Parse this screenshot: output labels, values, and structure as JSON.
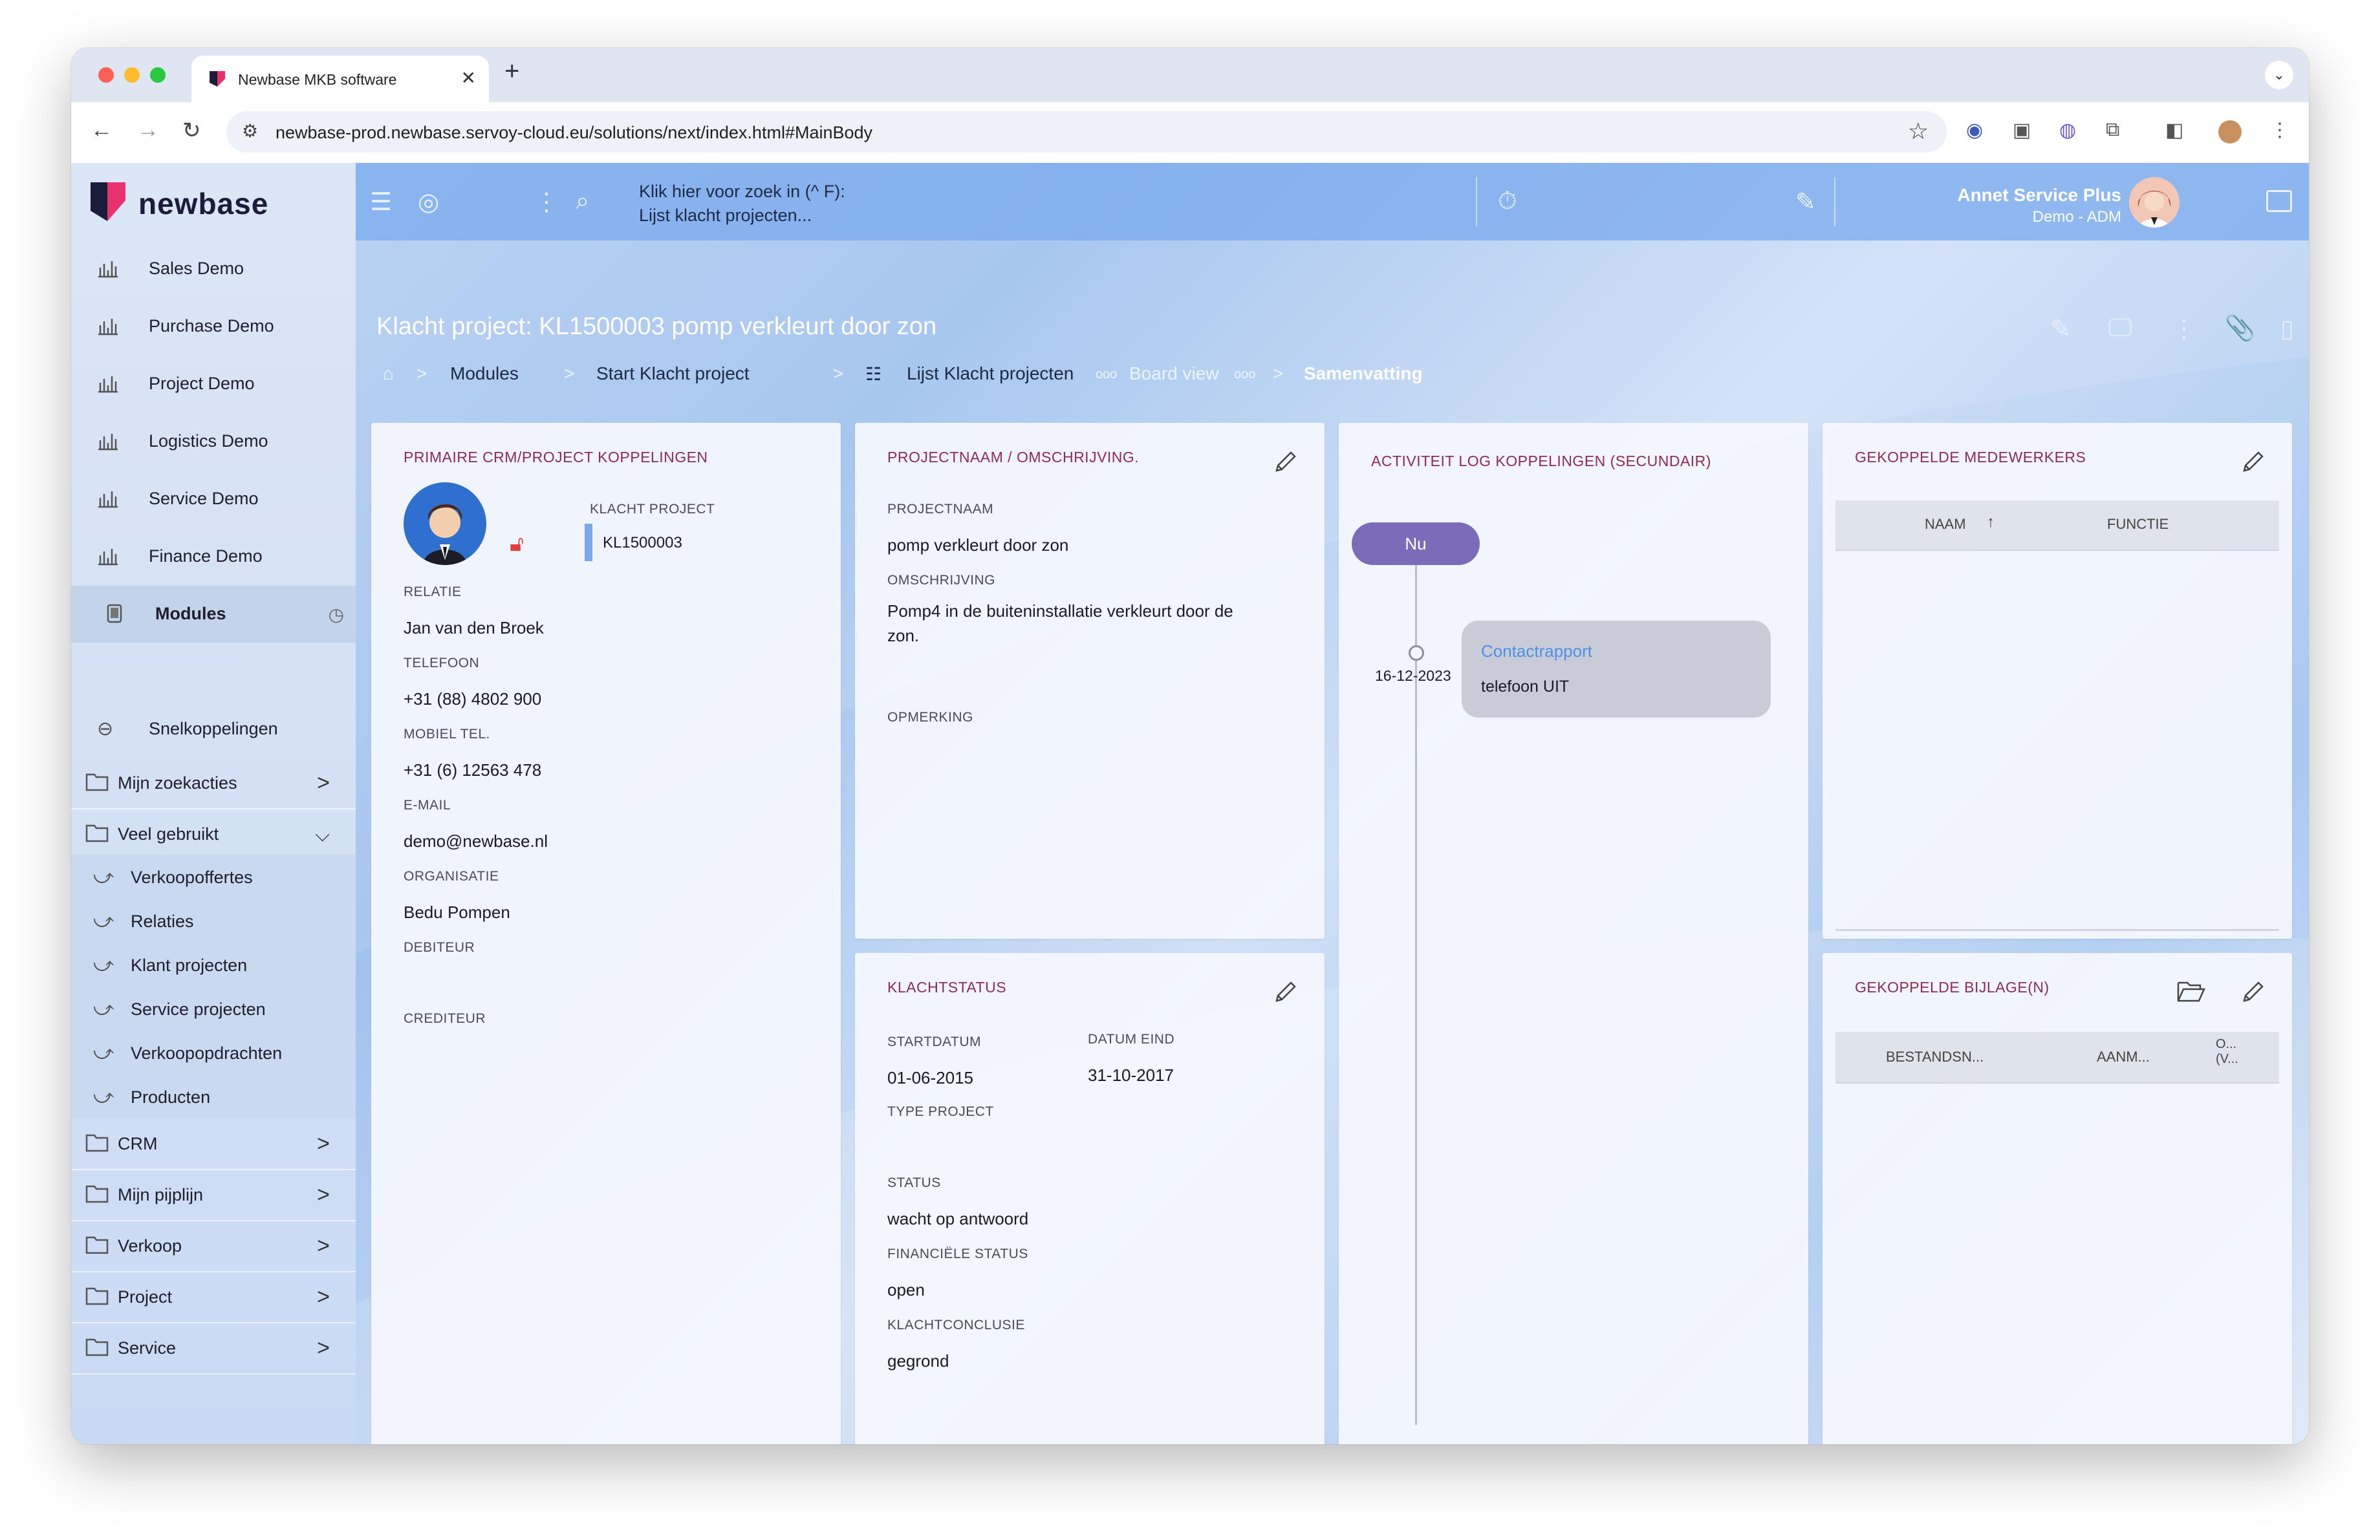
{
  "browser": {
    "tab_title": "Newbase MKB software",
    "url": "newbase-prod.newbase.servoy-cloud.eu/solutions/next/index.html#MainBody"
  },
  "app": {
    "logo_text": "newbase",
    "brand_color": "#e8316e",
    "accent_color": "#8e2a57"
  },
  "sidebar": {
    "modules": [
      {
        "label": "Sales Demo",
        "icon": "bar-chart-icon"
      },
      {
        "label": "Purchase Demo",
        "icon": "bar-chart-icon"
      },
      {
        "label": "Project Demo",
        "icon": "bar-chart-icon"
      },
      {
        "label": "Logistics Demo",
        "icon": "bar-chart-icon"
      },
      {
        "label": "Service Demo",
        "icon": "bar-chart-icon"
      },
      {
        "label": "Finance Demo",
        "icon": "bar-chart-icon"
      },
      {
        "label": "Modules",
        "icon": "tablet-icon",
        "active": true
      }
    ],
    "shortcuts_label": "Snelkoppelingen",
    "groups_top": [
      {
        "label": "Mijn zoekacties",
        "expanded": false
      },
      {
        "label": "Veel gebruikt",
        "expanded": true
      }
    ],
    "veel_gebruikt_items": [
      "Verkoopoffertes",
      "Relaties",
      "Klant projecten",
      "Service projecten",
      "Verkoopopdrachten",
      "Producten"
    ],
    "groups_bottom": [
      "CRM",
      "Mijn pijplijn",
      "Verkoop",
      "Project",
      "Service"
    ]
  },
  "topbar": {
    "search_line1": "Klik hier voor zoek in (^ F):",
    "search_line2": "Lijst klacht projecten...",
    "user_name": "Annet Service Plus",
    "user_role": "Demo - ADM"
  },
  "header": {
    "title": "Klacht project: KL1500003 pomp verkleurt door zon",
    "breadcrumbs": {
      "modules": "Modules",
      "start": "Start Klacht project",
      "lijst": "Lijst Klacht projecten",
      "board": "Board view",
      "current": "Samenvatting"
    }
  },
  "crm_card": {
    "title": "PRIMAIRE CRM/PROJECT KOPPELINGEN",
    "klacht_project_label": "KLACHT PROJECT",
    "klacht_project_value": "KL1500003",
    "relatie_label": "RELATIE",
    "relatie_value": "Jan van den Broek",
    "telefoon_label": "TELEFOON",
    "telefoon_value": "+31 (88) 4802 900",
    "mobiel_label": "MOBIEL TEL.",
    "mobiel_value": "+31 (6) 12563 478",
    "email_label": "E-MAIL",
    "email_value": "demo@newbase.nl",
    "organisatie_label": "ORGANISATIE",
    "organisatie_value": "Bedu Pompen",
    "debiteur_label": "DEBITEUR",
    "crediteur_label": "CREDITEUR"
  },
  "project_card": {
    "title": "PROJECTNAAM / OMSCHRIJVING.",
    "projectnaam_label": "PROJECTNAAM",
    "projectnaam_value": "pomp verkleurt door zon",
    "omschrijving_label": "OMSCHRIJVING",
    "omschrijving_line1": "Pomp4 in de buiteninstallatie verkleurt door de",
    "omschrijving_line2": "zon.",
    "opmerking_label": "OPMERKING"
  },
  "status_card": {
    "title": "KLACHTSTATUS",
    "startdatum_label": "STARTDATUM",
    "startdatum_value": "01-06-2015",
    "datum_eind_label": "DATUM EIND",
    "datum_eind_value": "31-10-2017",
    "type_label": "TYPE PROJECT",
    "status_label": "STATUS",
    "status_value": "wacht op antwoord",
    "fin_label": "FINANCIËLE STATUS",
    "fin_value": "open",
    "conclusie_label": "KLACHTCONCLUSIE",
    "conclusie_value": "gegrond"
  },
  "activity_card": {
    "title": "ACTIVITEIT LOG KOPPELINGEN (SECUNDAIR)",
    "now_label": "Nu",
    "entry_date": "16-12-2023",
    "entry_title": "Contactrapport",
    "entry_text": "telefoon UIT"
  },
  "employees_card": {
    "title": "GEKOPPELDE MEDEWERKERS",
    "col_naam": "NAAM",
    "col_functie": "FUNCTIE"
  },
  "attachments_card": {
    "title": "GEKOPPELDE BIJLAGE(N)",
    "col1": "BESTANDSN...",
    "col2": "AANM...",
    "col3_line1": "O...",
    "col3_line2": "(V..."
  }
}
